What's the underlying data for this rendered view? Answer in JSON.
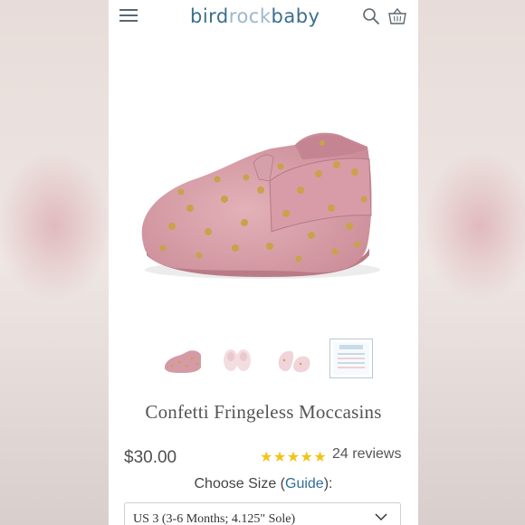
{
  "header": {
    "logo": {
      "part1": "bird",
      "part2": "rock",
      "part3": "baby"
    },
    "icons": {
      "menu": "hamburger-menu-icon",
      "search": "search-icon",
      "cart": "basket-icon"
    }
  },
  "product": {
    "title": "Confetti Fringeless Moccasins",
    "price": "$30.00",
    "rating": {
      "stars": "★★★★★",
      "value": 5,
      "reviews": "24 reviews"
    },
    "size": {
      "label_prefix": "Choose Size (",
      "guide_link": "Guide",
      "label_suffix": "):",
      "selected": "US 3 (3-6 Months; 4.125\" Sole)"
    }
  },
  "colors": {
    "brand_blue": "#3b6f8f",
    "brand_light_blue": "#9bb9c9",
    "star_yellow": "#f2c318",
    "link_blue": "#2f6f9a",
    "shoe_pink": "#d9a0aa",
    "dot_gold": "#c9a24a"
  }
}
